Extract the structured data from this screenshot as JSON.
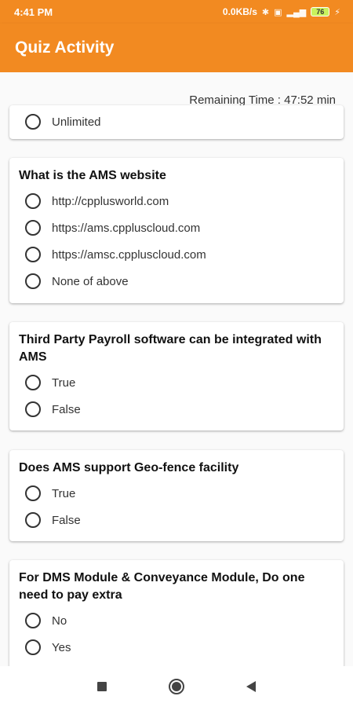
{
  "status": {
    "time": "4:41 PM",
    "network": "0.0KB/s",
    "battery": "76"
  },
  "appbar": {
    "title": "Quiz Activity"
  },
  "timer": {
    "text": "Remaining Time : 47:52 min"
  },
  "questions": [
    {
      "text": "",
      "options": [
        "Unlimited"
      ]
    },
    {
      "text": "What is the AMS website",
      "options": [
        "http://cpplusworld.com",
        "https://ams.cppluscloud.com",
        "https://amsc.cppluscloud.com",
        "None of above"
      ]
    },
    {
      "text": "Third Party Payroll software can be integrated with AMS",
      "options": [
        "True",
        "False"
      ]
    },
    {
      "text": "Does AMS support Geo-fence facility",
      "options": [
        "True",
        "False"
      ]
    },
    {
      "text": "For DMS Module & Conveyance Module, Do one need to pay extra",
      "options": [
        "No",
        "Yes"
      ]
    }
  ],
  "colors": {
    "accent": "#f28a21"
  },
  "icons": [
    "bluetooth-icon",
    "sim-icon",
    "signal-icon",
    "battery-icon",
    "recents-icon",
    "home-icon",
    "back-icon"
  ]
}
